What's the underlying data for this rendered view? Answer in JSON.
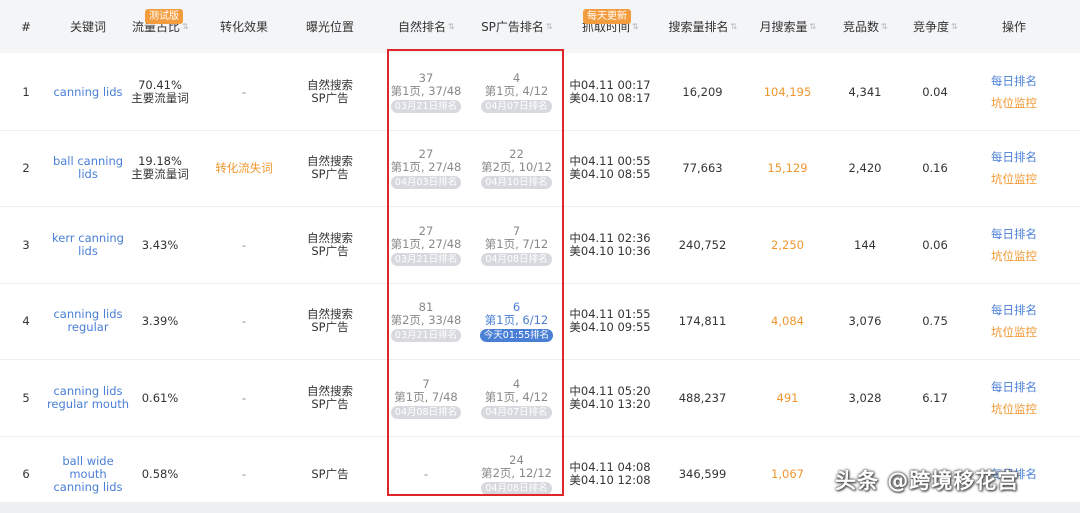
{
  "headers": {
    "num": "#",
    "keyword": "关键词",
    "traffic_share": "流量占比",
    "traffic_badge": "测试版",
    "conversion": "转化效果",
    "exposure": "曝光位置",
    "natural_rank": "自然排名",
    "sp_rank": "SP广告排名",
    "fetch_time": "抓取时间",
    "fetch_badge": "每天更新",
    "search_rank": "搜索量排名",
    "monthly_search": "月搜索量",
    "competitors": "竞品数",
    "competition": "竞争度",
    "actions": "操作"
  },
  "rows": [
    {
      "num": "1",
      "keyword": "canning lids",
      "share": "70.41%",
      "share_note": "主要流量词",
      "conversion": "-",
      "exposure1": "自然搜索",
      "exposure2": "SP广告",
      "nat_rank": "37",
      "nat_page": "第1页, 37/48",
      "nat_date": "03月21日排名",
      "sp_rank": "4",
      "sp_page": "第1页, 4/12",
      "sp_date": "04月07日排名",
      "time_cn": "中04.11 00:17",
      "time_us": "美04.10 08:17",
      "search_rank": "16,209",
      "monthly": "104,195",
      "competitors": "4,341",
      "competition": "0.04",
      "action1": "每日排名",
      "action2": "坑位监控"
    },
    {
      "num": "2",
      "keyword": "ball canning lids",
      "share": "19.18%",
      "share_note": "主要流量词",
      "conversion": "转化流失词",
      "exposure1": "自然搜索",
      "exposure2": "SP广告",
      "nat_rank": "27",
      "nat_page": "第1页, 27/48",
      "nat_date": "04月03日排名",
      "sp_rank": "22",
      "sp_page": "第2页, 10/12",
      "sp_date": "04月10日排名",
      "time_cn": "中04.11 00:55",
      "time_us": "美04.10 08:55",
      "search_rank": "77,663",
      "monthly": "15,129",
      "competitors": "2,420",
      "competition": "0.16",
      "action1": "每日排名",
      "action2": "坑位监控"
    },
    {
      "num": "3",
      "keyword": "kerr canning lids",
      "share": "3.43%",
      "share_note": "",
      "conversion": "-",
      "exposure1": "自然搜索",
      "exposure2": "SP广告",
      "nat_rank": "27",
      "nat_page": "第1页, 27/48",
      "nat_date": "03月21日排名",
      "sp_rank": "7",
      "sp_page": "第1页, 7/12",
      "sp_date": "04月08日排名",
      "time_cn": "中04.11 02:36",
      "time_us": "美04.10 10:36",
      "search_rank": "240,752",
      "monthly": "2,250",
      "competitors": "144",
      "competition": "0.06",
      "action1": "每日排名",
      "action2": "坑位监控"
    },
    {
      "num": "4",
      "keyword": "canning lids regular",
      "share": "3.39%",
      "share_note": "",
      "conversion": "-",
      "exposure1": "自然搜索",
      "exposure2": "SP广告",
      "nat_rank": "81",
      "nat_page": "第2页, 33/48",
      "nat_date": "03月21日排名",
      "sp_rank": "6",
      "sp_page": "第1页, 6/12",
      "sp_date": "今天01:55排名",
      "time_cn": "中04.11 01:55",
      "time_us": "美04.10 09:55",
      "search_rank": "174,811",
      "monthly": "4,084",
      "competitors": "3,076",
      "competition": "0.75",
      "action1": "每日排名",
      "action2": "坑位监控"
    },
    {
      "num": "5",
      "keyword": "canning lids regular mouth",
      "share": "0.61%",
      "share_note": "",
      "conversion": "-",
      "exposure1": "自然搜索",
      "exposure2": "SP广告",
      "nat_rank": "7",
      "nat_page": "第1页, 7/48",
      "nat_date": "04月08日排名",
      "sp_rank": "4",
      "sp_page": "第1页, 4/12",
      "sp_date": "04月07日排名",
      "time_cn": "中04.11 05:20",
      "time_us": "美04.10 13:20",
      "search_rank": "488,237",
      "monthly": "491",
      "competitors": "3,028",
      "competition": "6.17",
      "action1": "每日排名",
      "action2": "坑位监控"
    },
    {
      "num": "6",
      "keyword": "ball wide mouth canning lids",
      "share": "0.58%",
      "share_note": "",
      "conversion": "-",
      "exposure1": "SP广告",
      "exposure2": "",
      "nat_rank": "",
      "nat_page": "-",
      "nat_date": "",
      "sp_rank": "24",
      "sp_page": "第2页, 12/12",
      "sp_date": "04月08日排名",
      "time_cn": "中04.11 04:08",
      "time_us": "美04.10 12:08",
      "search_rank": "346,599",
      "monthly": "1,067",
      "competitors": "",
      "competition": "",
      "action1": "每日排名",
      "action2": ""
    }
  ],
  "watermark": "头条 @跨境移花宫",
  "colors": {
    "accent": "#4a7fd6",
    "orange": "#f0962e",
    "highlight_border": "#e0262a"
  }
}
